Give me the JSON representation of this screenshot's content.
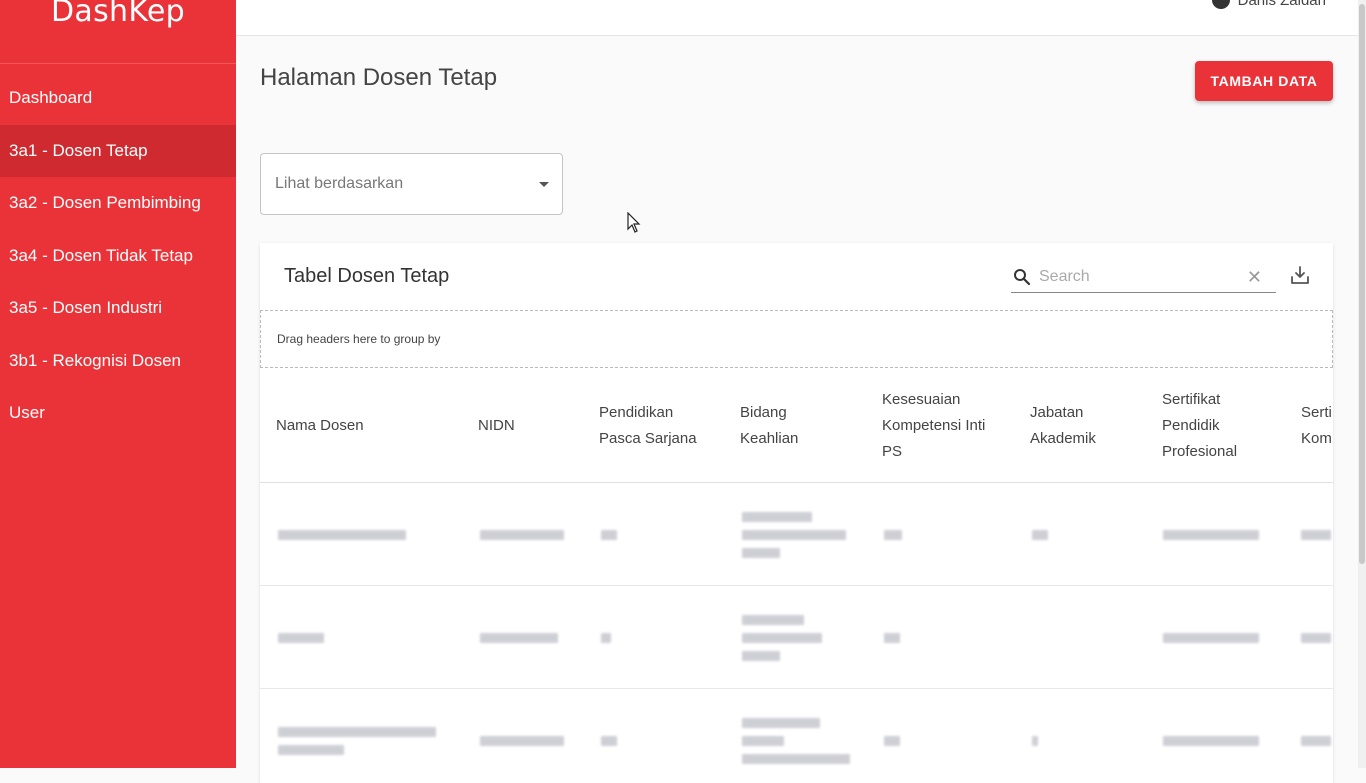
{
  "brand": "DashKep",
  "colors": {
    "accent": "#ea3339",
    "accent_active": "#cf2a30"
  },
  "user": {
    "name": "Danis Zaidan",
    "icon": "account-circle-icon"
  },
  "sidebar": {
    "items": [
      {
        "label": "Dashboard",
        "active": false
      },
      {
        "label": "3a1 - Dosen Tetap",
        "active": true
      },
      {
        "label": "3a2 - Dosen Pembimbing",
        "active": false
      },
      {
        "label": "3a4 - Dosen Tidak Tetap",
        "active": false
      },
      {
        "label": "3a5 - Dosen Industri",
        "active": false
      },
      {
        "label": "3b1 - Rekognisi Dosen",
        "active": false
      },
      {
        "label": "User",
        "active": false
      }
    ]
  },
  "page": {
    "title": "Halaman Dosen Tetap",
    "add_button": "TAMBAH DATA",
    "filter_placeholder": "Lihat berdasarkan"
  },
  "table": {
    "title": "Tabel Dosen Tetap",
    "search_placeholder": "Search",
    "group_hint": "Drag headers here to group by",
    "columns": [
      {
        "label": "Nama Dosen"
      },
      {
        "label": "NIDN"
      },
      {
        "label": "Pendidikan Pasca Sarjana"
      },
      {
        "label": "Bidang Keahlian"
      },
      {
        "label": "Kesesuaian Kompetensi Inti PS"
      },
      {
        "label": "Jabatan Akademik"
      },
      {
        "label": "Sertifikat Pendidik Profesional"
      },
      {
        "label": "Serti Kom"
      }
    ],
    "rows_note": "row contents are blurred/pixelated in the screenshot"
  }
}
